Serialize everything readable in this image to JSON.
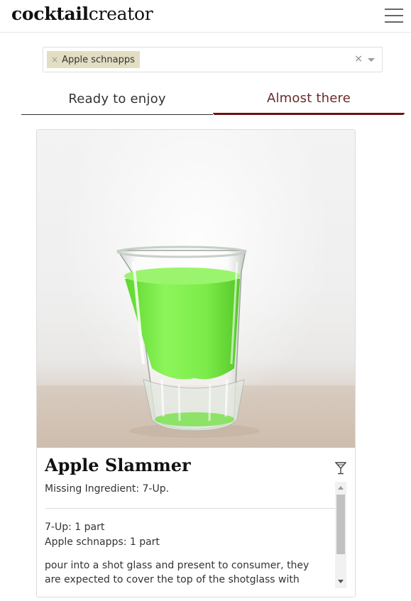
{
  "header": {
    "brand_bold": "cocktail",
    "brand_light": "creator",
    "menu_icon": "hamburger-menu-icon"
  },
  "filter": {
    "chips": [
      {
        "label": "Apple schnapps",
        "remove": "×"
      }
    ],
    "clear": "×",
    "dropdown_icon": "caret-down-icon"
  },
  "tabs": [
    {
      "label": "Ready to enjoy",
      "active": false
    },
    {
      "label": "Almost there",
      "active": true
    }
  ],
  "colors": {
    "accent": "#6b1212",
    "chip_background": "#e2dec4",
    "drink_green": "#7df04a"
  },
  "card": {
    "title": "Apple Slammer",
    "glass_icon": "cocktail-glass-icon",
    "missing": "Missing Ingredient: 7-Up.",
    "ingredients": [
      "7-Up: 1 part",
      "Apple schnapps: 1 part"
    ],
    "instructions": "pour into a shot glass and present to consumer, they are expected to cover the top of the shotglass with thier"
  }
}
